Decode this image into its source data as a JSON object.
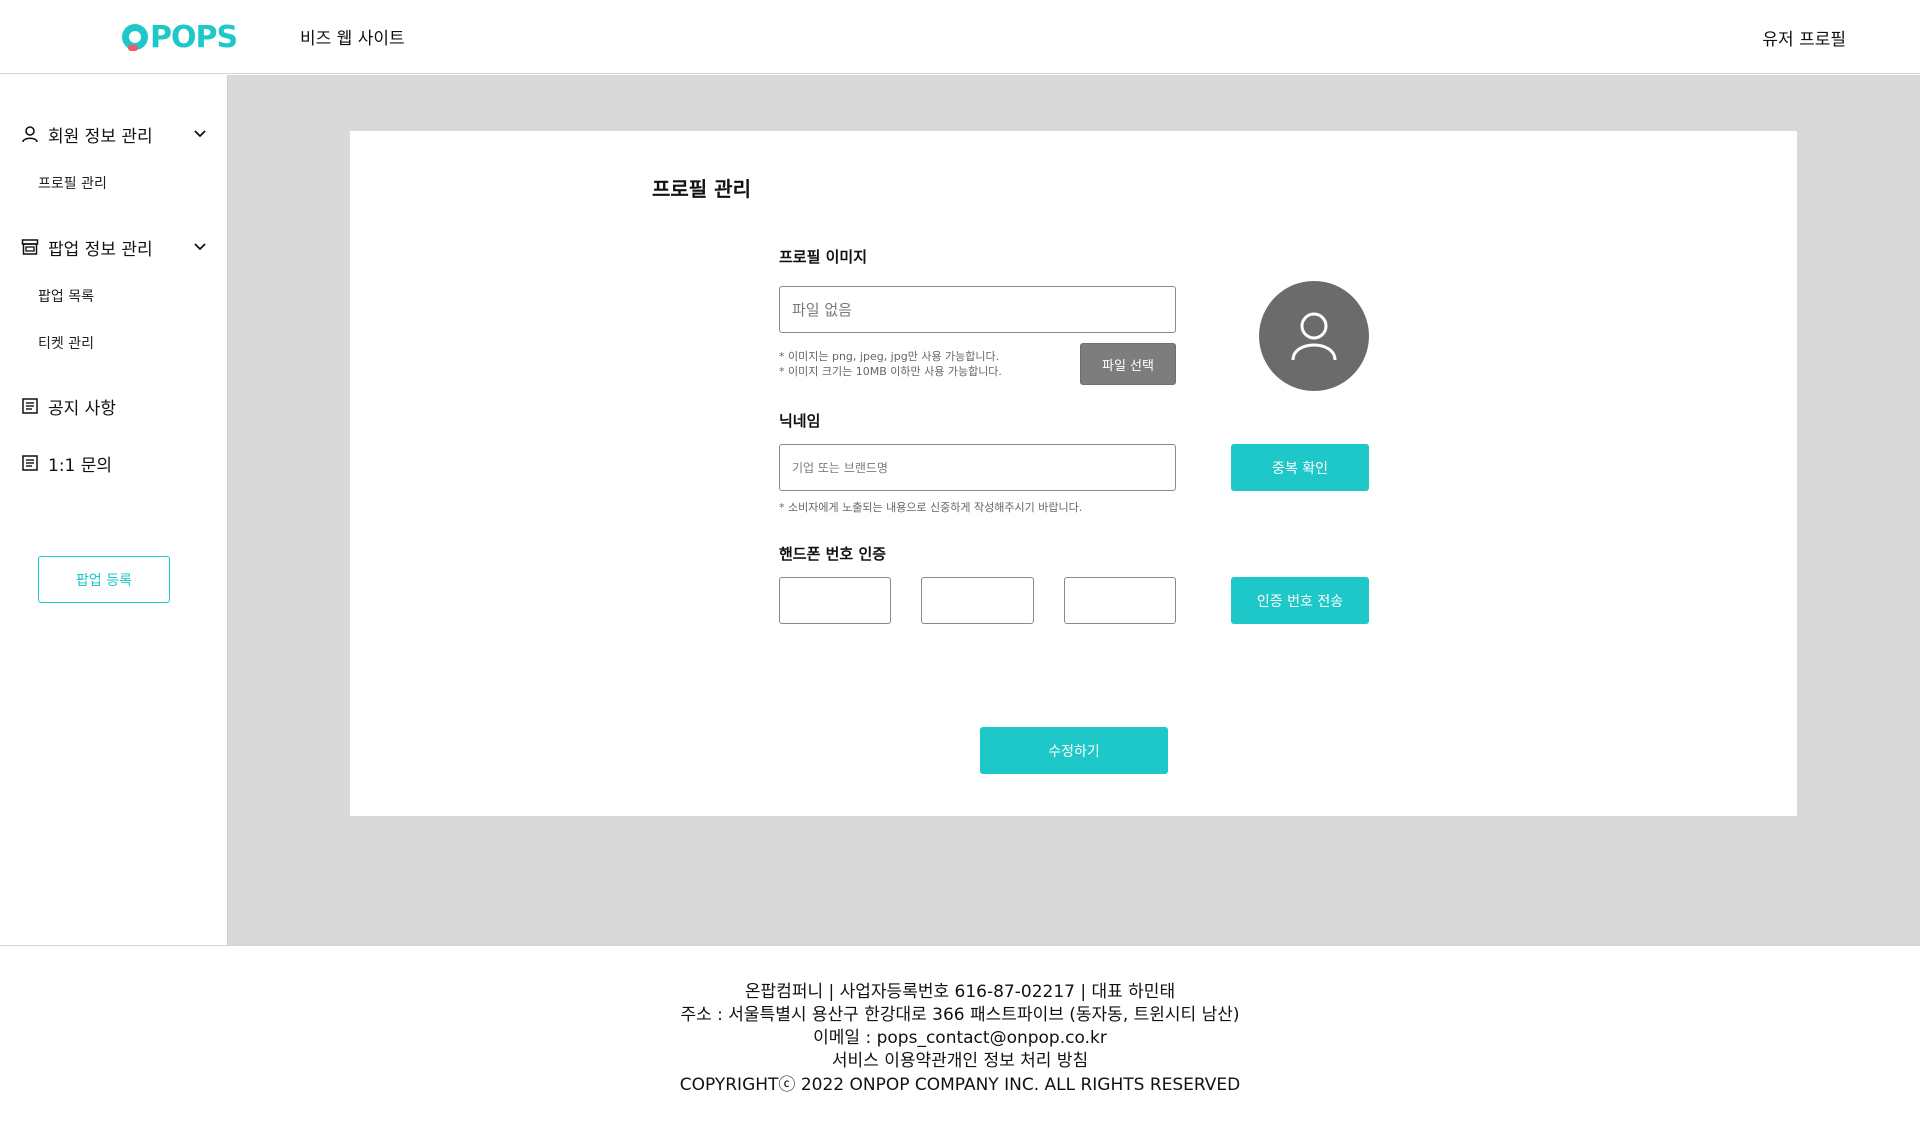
{
  "header": {
    "logo_text": "OPOPS",
    "biz_site_link": "비즈 웹 사이트",
    "user_profile_link": "유저 프로필"
  },
  "sidebar": {
    "groups": [
      {
        "label": "회원 정보 관리",
        "icon": "user-icon",
        "sub_items": [
          "프로필 관리"
        ]
      },
      {
        "label": "팝업 정보 관리",
        "icon": "store-icon",
        "sub_items": [
          "팝업 목록",
          "티켓 관리"
        ]
      }
    ],
    "links": [
      {
        "label": "공지 사항",
        "icon": "document-icon"
      },
      {
        "label": "1:1 문의",
        "icon": "document-icon"
      }
    ],
    "register_button": "팝업 등록"
  },
  "main": {
    "title": "프로필 관리",
    "profile_image": {
      "label": "프로필 이미지",
      "file_placeholder": "파일 없음",
      "hint_lines": [
        "* 이미지는 png, jpeg, jpg만 사용 가능합니다.",
        "* 이미지 크기는 10MB 이하만 사용 가능합니다."
      ],
      "file_button": "파일 선택",
      "avatar_icon": "user-avatar-icon"
    },
    "nickname": {
      "label": "닉네임",
      "placeholder": "기업 또는 브랜드명",
      "hint": "* 소비자에게 노출되는 내용으로 신중하게 작성해주시기 바랍니다.",
      "check_button": "중복 확인"
    },
    "phone": {
      "label": "핸드폰 번호 인증",
      "part1": "",
      "part2": "",
      "part3": "",
      "send_button": "인증 번호 전송"
    },
    "submit_button": "수정하기"
  },
  "footer": {
    "lines": [
      "온팝컴퍼니 | 사업자등록번호 616-87-02217 | 대표 하민태",
      "주소 : 서울특별시 용산구 한강대로 366 패스트파이브 (동자동, 트윈시티 남산)",
      "이메일 : pops_contact@onpop.co.kr",
      "서비스 이용약관개인 정보 처리 방침",
      "COPYRIGHTⓒ 2022 ONPOP COMPANY INC. ALL RIGHTS RESERVED"
    ]
  },
  "colors": {
    "accent": "#1ec8c8",
    "gray_button": "#7d7d7d",
    "background": "#d9d9d9",
    "avatar": "#6b6b6b"
  }
}
